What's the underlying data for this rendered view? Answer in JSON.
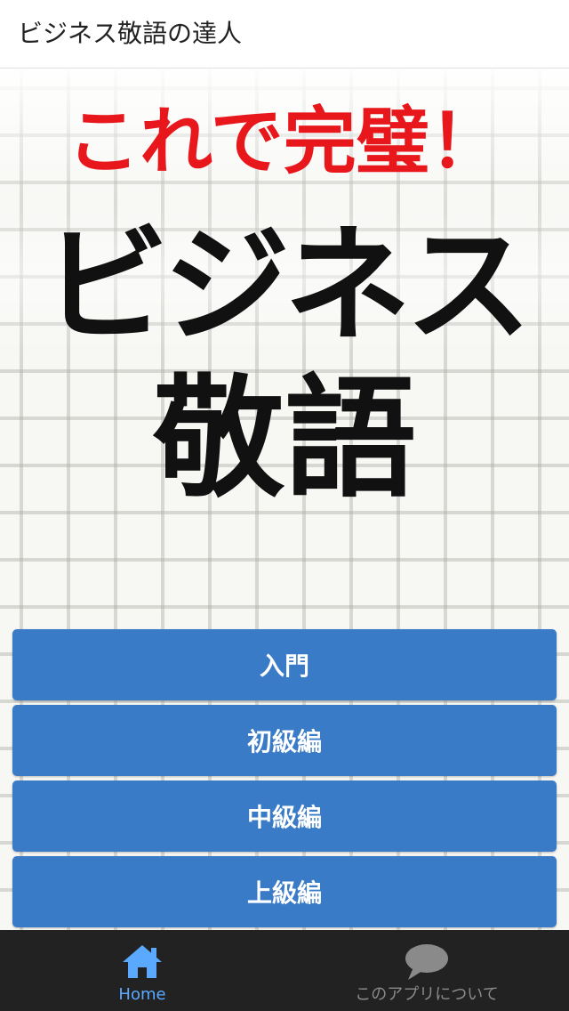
{
  "app_bar": {
    "title": "ビジネス敬語の達人"
  },
  "hero": {
    "subtitle": "これで完璧！",
    "title_line1": "ビジネス",
    "title_line2": "敬語"
  },
  "menu": {
    "items": [
      {
        "label": "入門"
      },
      {
        "label": "初級編"
      },
      {
        "label": "中級編"
      },
      {
        "label": "上級編"
      }
    ]
  },
  "tab_bar": {
    "tabs": [
      {
        "label": "Home",
        "icon": "home-icon",
        "active": true
      },
      {
        "label": "このアプリについて",
        "icon": "chat-bubble-icon",
        "active": false
      }
    ]
  },
  "colors": {
    "accent": "#3a7bc8",
    "active_tab": "#5aa9ff",
    "hero_red": "#e8171c",
    "tab_bar_bg": "#222222"
  }
}
